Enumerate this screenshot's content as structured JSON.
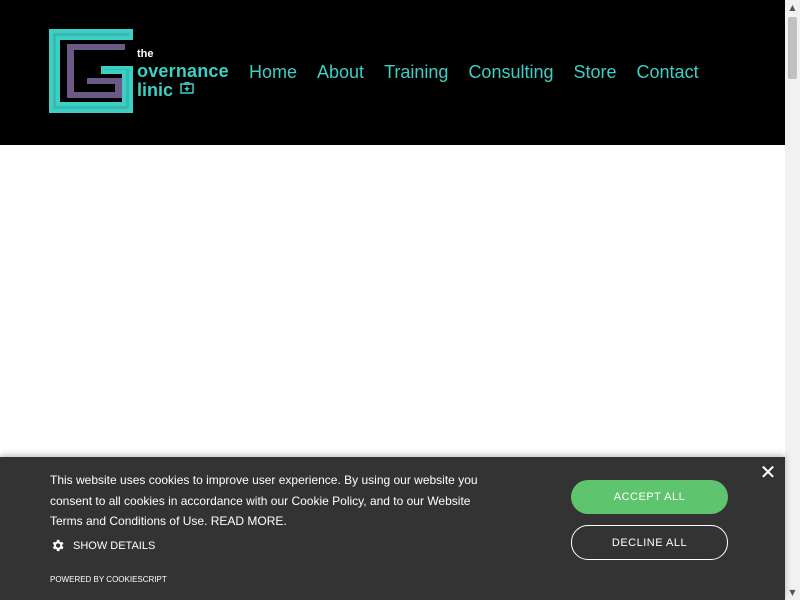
{
  "brand": {
    "the": "the",
    "line1": "overnance",
    "line2": "linic",
    "colors": {
      "accent": "#3ecfc4",
      "purple": "#6b5a86",
      "header_bg": "#000000"
    }
  },
  "nav": {
    "items": [
      {
        "label": "Home"
      },
      {
        "label": "About"
      },
      {
        "label": "Training"
      },
      {
        "label": "Consulting"
      },
      {
        "label": "Store"
      },
      {
        "label": "Contact"
      }
    ]
  },
  "cookie": {
    "message": "This website uses cookies to improve user experience. By using our website you consent to all cookies in accordance with our Cookie Policy, and to our Website Terms and Conditions of Use. READ MORE.",
    "show_details": "SHOW DETAILS",
    "powered_by": "POWERED BY COOKIESCRIPT",
    "accept_label": "ACCEPT ALL",
    "decline_label": "DECLINE ALL",
    "close_symbol": "✕",
    "icons": {
      "details": "gear-icon",
      "close": "close-icon"
    },
    "colors": {
      "banner_bg": "#333333",
      "accept_bg": "#5fc46e"
    }
  }
}
